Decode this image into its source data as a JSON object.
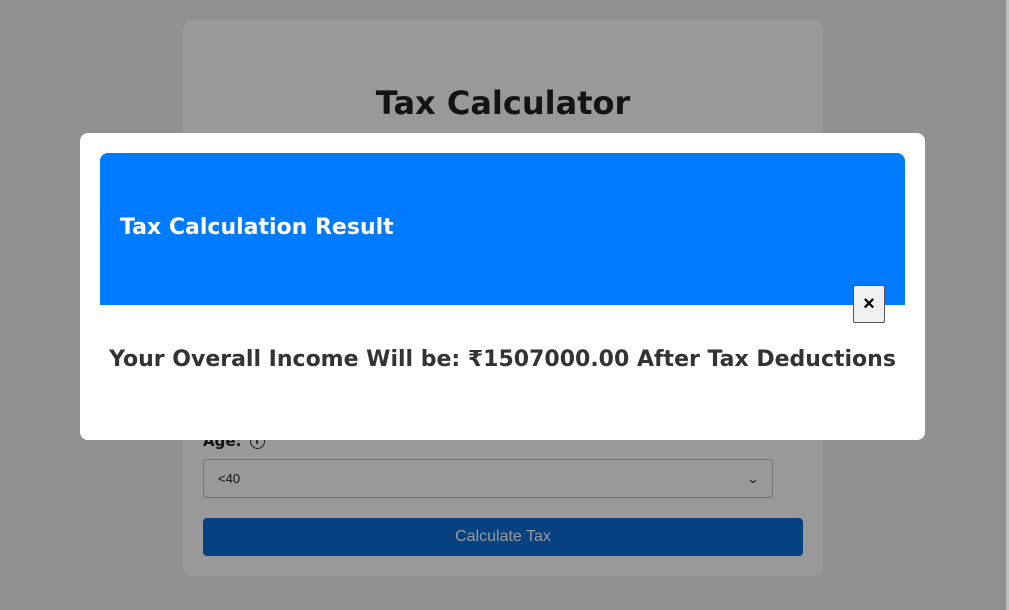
{
  "form": {
    "title": "Tax Calculator",
    "age_label": "Age:",
    "age_value": "<40",
    "calculate_label": "Calculate Tax"
  },
  "modal": {
    "title": "Tax Calculation Result",
    "close_glyph": "×",
    "result_text": "Your Overall Income Will be: ₹1507000.00 After Tax Deductions"
  },
  "icons": {
    "info": "info-circle-icon",
    "close": "close-icon",
    "chevron": "chevron-down-icon"
  },
  "colors": {
    "header": "#007bff",
    "button": "#0a6dd9",
    "overlay": "rgba(0,0,0,0.4)"
  }
}
